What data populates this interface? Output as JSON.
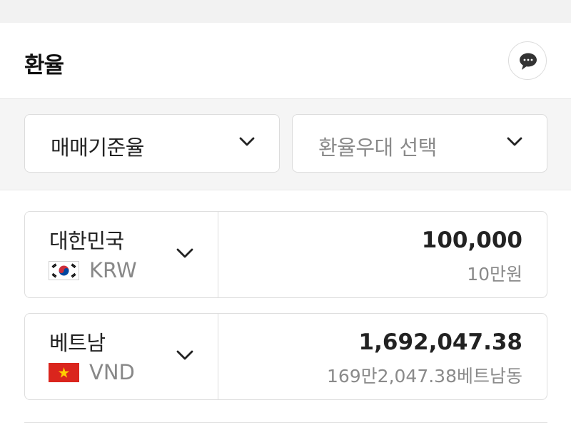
{
  "header": {
    "title": "환율",
    "chat_icon": "chat-bubble-icon"
  },
  "filters": {
    "rate_type": {
      "value": "매매기준율"
    },
    "discount": {
      "placeholder": "환율우대 선택"
    }
  },
  "currencies": [
    {
      "country": "대한민국",
      "code": "KRW",
      "flag": "korea-flag-icon",
      "amount": "100,000",
      "amount_text": "10만원"
    },
    {
      "country": "베트남",
      "code": "VND",
      "flag": "vietnam-flag-icon",
      "amount": "1,692,047.38",
      "amount_text": "169만2,047.38베트남동"
    }
  ],
  "colors": {
    "text": "#1e1e1e",
    "muted": "#8a8a8a",
    "border": "#dedede",
    "band": "#f5f5f5",
    "vn_red": "#da251d",
    "vn_star": "#ffcd00"
  }
}
